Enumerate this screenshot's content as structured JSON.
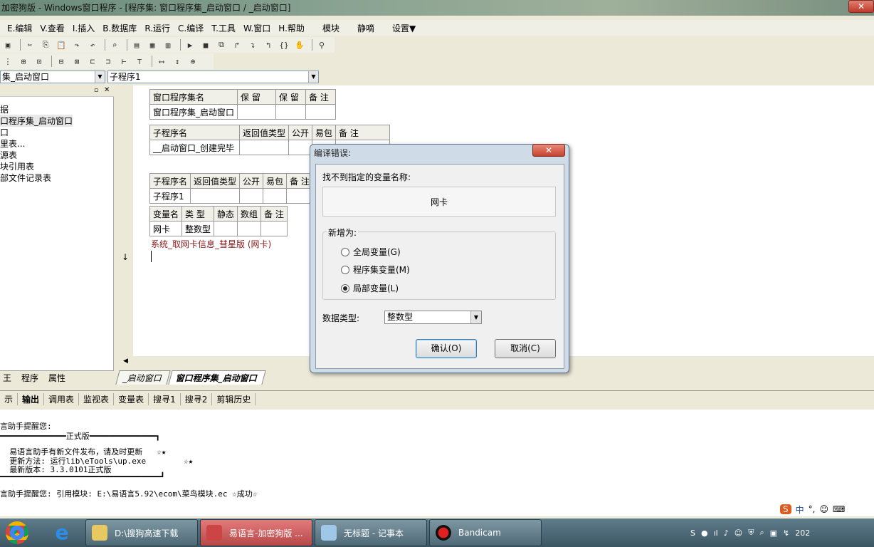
{
  "window": {
    "title": "加密狗版 - Windows窗口程序 - [程序集: 窗口程序集_启动窗口 / _启动窗口]",
    "close_glyph": "✕"
  },
  "menubar": {
    "items": [
      "E.编辑",
      "V.查看",
      "I.插入",
      "B.数据库",
      "R.运行",
      "C.编译",
      "T.工具",
      "W.窗口",
      "H.帮助"
    ],
    "extras": [
      "模块",
      "静嘀",
      "设置▼"
    ]
  },
  "toolbar": {
    "row1_icons": [
      "save-icon",
      "cut-icon",
      "copy-icon",
      "paste-icon",
      "redo-icon",
      "undo-icon",
      "find-icon",
      "layout1-icon",
      "layout2-icon",
      "layout3-icon",
      "run-icon",
      "stop-icon",
      "step-icon",
      "step-into-icon",
      "step-over-icon",
      "step-out-icon",
      "braces-icon",
      "hand-icon",
      "binoculars-icon"
    ],
    "row1_glyphs": [
      "▣",
      "✂",
      "⎘",
      "📋",
      "↷",
      "↶",
      "⌕",
      "▤",
      "▦",
      "▥",
      "▶",
      "■",
      "⧉",
      "↱",
      "↴",
      "↰",
      "{}",
      "✋",
      "⚲"
    ],
    "row2_glyphs": [
      "⋮",
      "⊞",
      "⊡",
      "⊟",
      "⊠",
      "⊏",
      "⊐",
      "⊢",
      "⊤",
      "⟷",
      "↕",
      "⊕"
    ]
  },
  "selectors": {
    "assembly": "集_启动窗口",
    "subprogram": "子程序1"
  },
  "tree": {
    "nodes": [
      "据",
      "口程序集_启动窗口",
      "口",
      "里表...",
      "源表",
      "块引用表",
      "部文件记录表"
    ],
    "tabs": [
      "王",
      "程序",
      "属性"
    ]
  },
  "code": {
    "table_assembly": {
      "headers": [
        "窗口程序集名",
        "保 留",
        "保 留",
        "备 注"
      ],
      "row": [
        "窗口程序集_启动窗口",
        "",
        "",
        ""
      ]
    },
    "table_sub1": {
      "headers": [
        "子程序名",
        "返回值类型",
        "公开",
        "易包",
        "备 注"
      ],
      "row": [
        "__启动窗口_创建完毕",
        "",
        "",
        "",
        ""
      ]
    },
    "table_sub2": {
      "headers": [
        "子程序名",
        "返回值类型",
        "公开",
        "易包",
        "备 注"
      ],
      "row": [
        "子程序1",
        "",
        "",
        "",
        ""
      ]
    },
    "table_vars": {
      "headers": [
        "变量名",
        "类 型",
        "静态",
        "数组",
        "备 注"
      ],
      "row": [
        "网卡",
        "整数型",
        "",
        "",
        ""
      ]
    },
    "code_line": "系统_取网卡信息_彗星版 (网卡)",
    "arrow": "↓",
    "tabs": [
      "_启动窗口",
      "窗口程序集_启动窗口"
    ]
  },
  "output_panel": {
    "tabs": [
      "示",
      "输出",
      "调用表",
      "监视表",
      "变量表",
      "搜寻1",
      "搜寻2",
      "剪辑历史"
    ],
    "lines": [
      "言助手提醒您:",
      "━━━━━━━━━━━━━━正式版━━━━━━━━━━━━━━┓",
      "  易语言助手有新文件发布，请及时更新   ☆★",
      "  更新方法: 运行lib\\eTools\\up.exe        ☆★",
      "  最新版本: 3.3.0101正式版",
      "━━━━━━━━━━━━━━━━━━━━━━━━━━━━━━━━━━┛",
      "言助手提醒您: 引用模块: E:\\易语言5.92\\ecom\\菜鸟模块.ec ☆成功☆"
    ]
  },
  "ime": {
    "items": [
      "S",
      "中",
      "°,",
      "☺",
      "⌨"
    ]
  },
  "taskbar": {
    "buttons": [
      "D:\\搜狗高速下载",
      "易语言-加密狗版 ...",
      "无标题 - 记事本",
      "Bandicam"
    ],
    "clock": "202"
  },
  "dialog": {
    "title": "编译错误:",
    "close_glyph": "✕",
    "message": "找不到指定的变量名称:",
    "variable": "网卡",
    "group_label": "新增为:",
    "options": [
      "全局变量(G)",
      "程序集变量(M)",
      "局部变量(L)"
    ],
    "selected_option": 2,
    "datatype_label": "数据类型:",
    "datatype_value": "整数型",
    "ok_label": "确认(O)",
    "cancel_label": "取消(C)"
  }
}
